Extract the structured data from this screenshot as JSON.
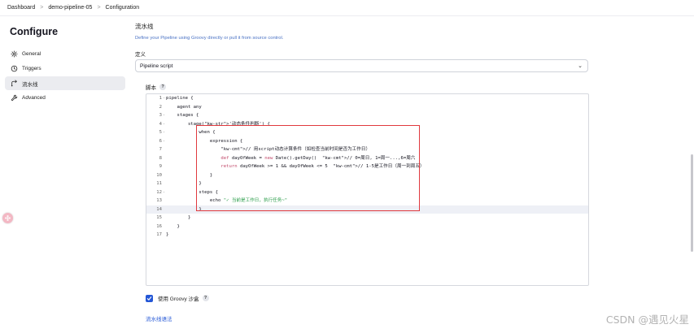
{
  "breadcrumb": {
    "items": [
      "Dashboard",
      "demo-pipeline-05",
      "Configuration"
    ],
    "separator": ">"
  },
  "page": {
    "title": "Configure"
  },
  "sidebar": {
    "items": [
      {
        "label": "General",
        "icon": "gear-icon",
        "active": false
      },
      {
        "label": "Triggers",
        "icon": "clock-icon",
        "active": false
      },
      {
        "label": "流水线",
        "icon": "pipeline-icon",
        "active": true
      },
      {
        "label": "Advanced",
        "icon": "wrench-icon",
        "active": false
      }
    ]
  },
  "pipeline": {
    "section_title": "流水线",
    "description": "Define your Pipeline using Groovy directly or pull it from source control.",
    "definition_label": "定义",
    "definition_value": "Pipeline script",
    "script_label": "脚本",
    "help_glyph": "?"
  },
  "editor": {
    "current_line": 14,
    "lines": [
      {
        "n": "1",
        "fold": "-",
        "text": "pipeline {"
      },
      {
        "n": "2",
        "fold": "",
        "text": "    agent any"
      },
      {
        "n": "3",
        "fold": "-",
        "text": "    stages {"
      },
      {
        "n": "4",
        "fold": "-",
        "text": "        stage('动态条件判断') {"
      },
      {
        "n": "5",
        "fold": "-",
        "text": "            when {"
      },
      {
        "n": "6",
        "fold": "-",
        "text": "                expression {"
      },
      {
        "n": "7",
        "fold": "",
        "text": "                    // 用script动态计算条件（如检查当前时间是否为工作日）"
      },
      {
        "n": "8",
        "fold": "",
        "text": "                    def dayOfWeek = new Date().getDay()  // 0=周日, 1=周一...,6=周六"
      },
      {
        "n": "9",
        "fold": "",
        "text": "                    return dayOfWeek >= 1 && dayOfWeek <= 5  // 1-5是工作日（周一到周五）"
      },
      {
        "n": "10",
        "fold": "",
        "text": "                }"
      },
      {
        "n": "11",
        "fold": "",
        "text": "            }"
      },
      {
        "n": "12",
        "fold": "-",
        "text": "            steps {"
      },
      {
        "n": "13",
        "fold": "",
        "text": "                echo \"✓ 当前是工作日，执行任务~\""
      },
      {
        "n": "14",
        "fold": "",
        "text": "            }"
      },
      {
        "n": "15",
        "fold": "",
        "text": "        }"
      },
      {
        "n": "16",
        "fold": "",
        "text": "    }"
      },
      {
        "n": "17",
        "fold": "",
        "text": "}"
      }
    ]
  },
  "groovy_sandbox": {
    "label": "使用 Groovy 沙盒",
    "checked": true
  },
  "syntax_link": "流水线语法",
  "watermark": "CSDN @遇见火星",
  "colors": {
    "accent": "#2457d6",
    "highlight_box": "#e0393e",
    "description_link": "#4a72c4",
    "active_nav_bg": "#ebecf0"
  }
}
